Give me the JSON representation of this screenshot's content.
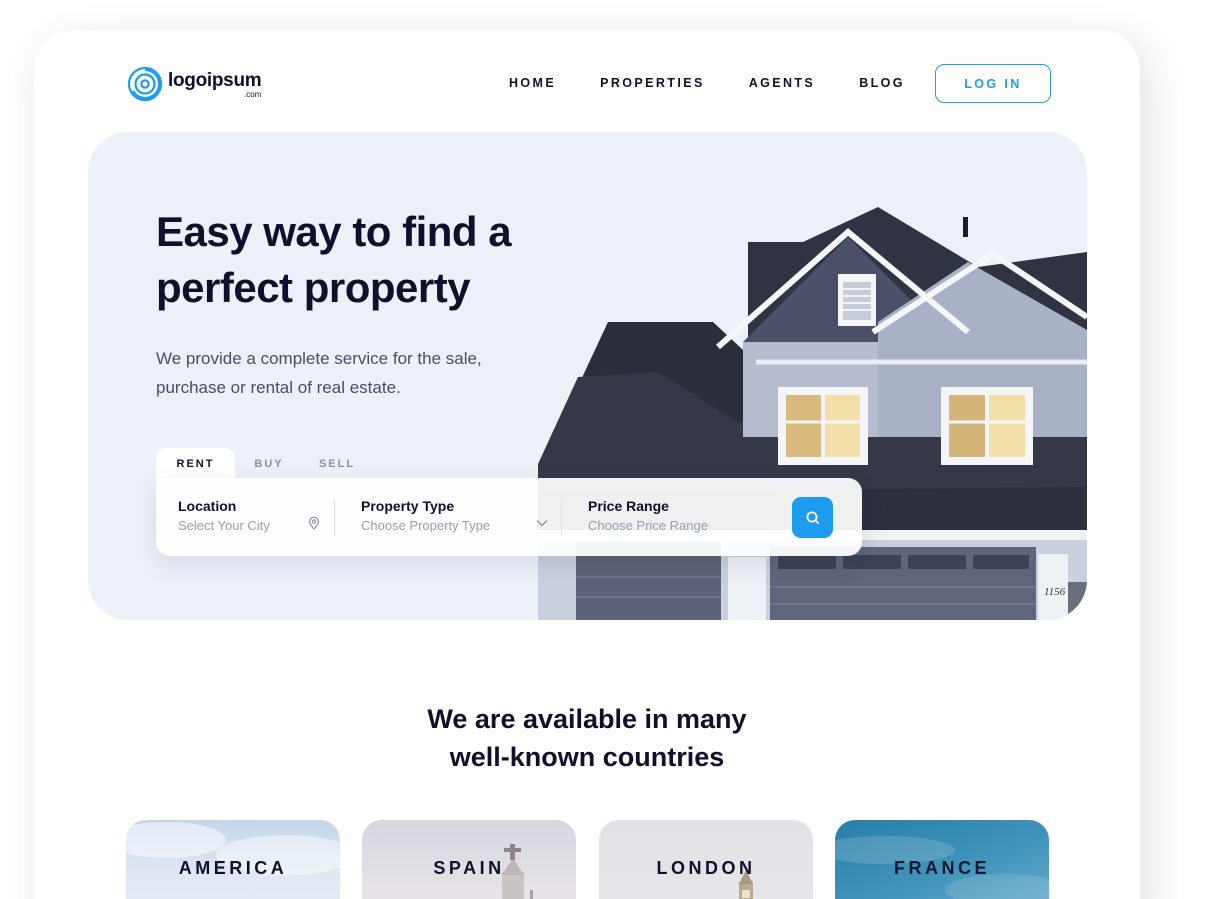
{
  "brand": {
    "name": "logoipsum",
    "tld": ".com",
    "accent": "#1e9cf0",
    "ink": "#120f2d"
  },
  "nav": {
    "items": [
      "HOME",
      "PROPERTIES",
      "AGENTS",
      "BLOG"
    ],
    "login_label": "LOG IN"
  },
  "hero": {
    "title": "Easy way to find a perfect property",
    "subtitle": "We provide a complete service for the sale, purchase or rental of real estate.",
    "house_number": "1156"
  },
  "search": {
    "tabs": [
      {
        "label": "RENT",
        "active": true
      },
      {
        "label": "BUY",
        "active": false
      },
      {
        "label": "SELL",
        "active": false
      }
    ],
    "location": {
      "label": "Location",
      "placeholder": "Select Your City",
      "icon": "map-pin-icon"
    },
    "property_type": {
      "label": "Property Type",
      "placeholder": "Choose Property Type",
      "icon": "chevron-down-icon"
    },
    "price_range": {
      "label": "Price Range",
      "placeholder": "Choose Price Range"
    },
    "button_icon": "search-icon"
  },
  "countries": {
    "title_line1": "We are available in many",
    "title_line2": "well-known countries",
    "items": [
      "AMERICA",
      "SPAIN",
      "LONDON",
      "FRANCE"
    ]
  }
}
